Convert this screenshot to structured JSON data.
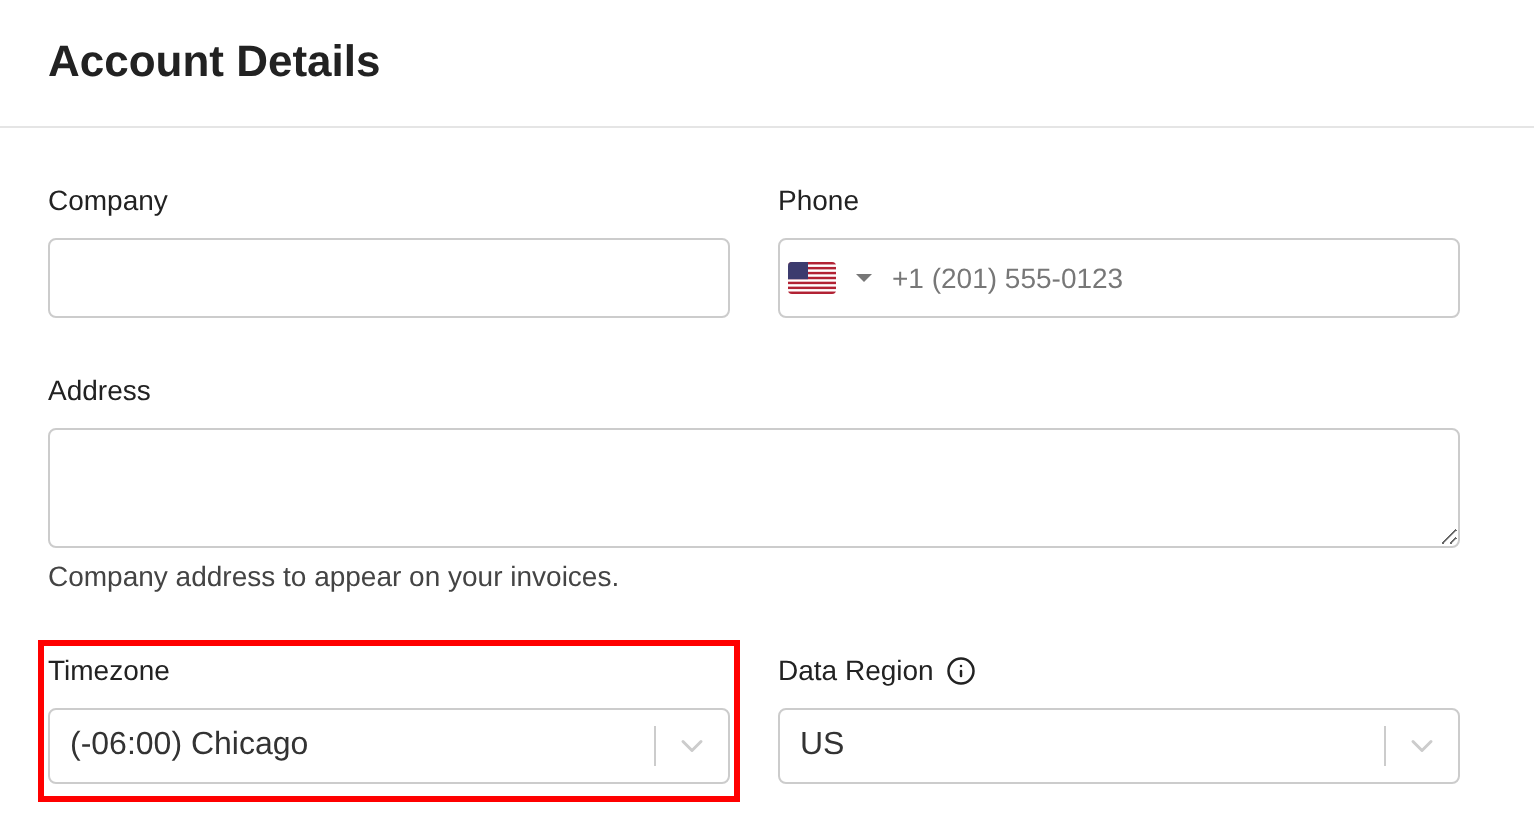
{
  "title": "Account Details",
  "company": {
    "label": "Company"
  },
  "phone": {
    "label": "Phone",
    "placeholder": "+1 (201) 555-0123"
  },
  "address": {
    "label": "Address",
    "help": "Company address to appear on your invoices."
  },
  "timezone": {
    "label": "Timezone",
    "value": "(-06:00) Chicago",
    "highlighted": true
  },
  "data_region": {
    "label": "Data Region",
    "value": "US",
    "highlighted": false
  }
}
